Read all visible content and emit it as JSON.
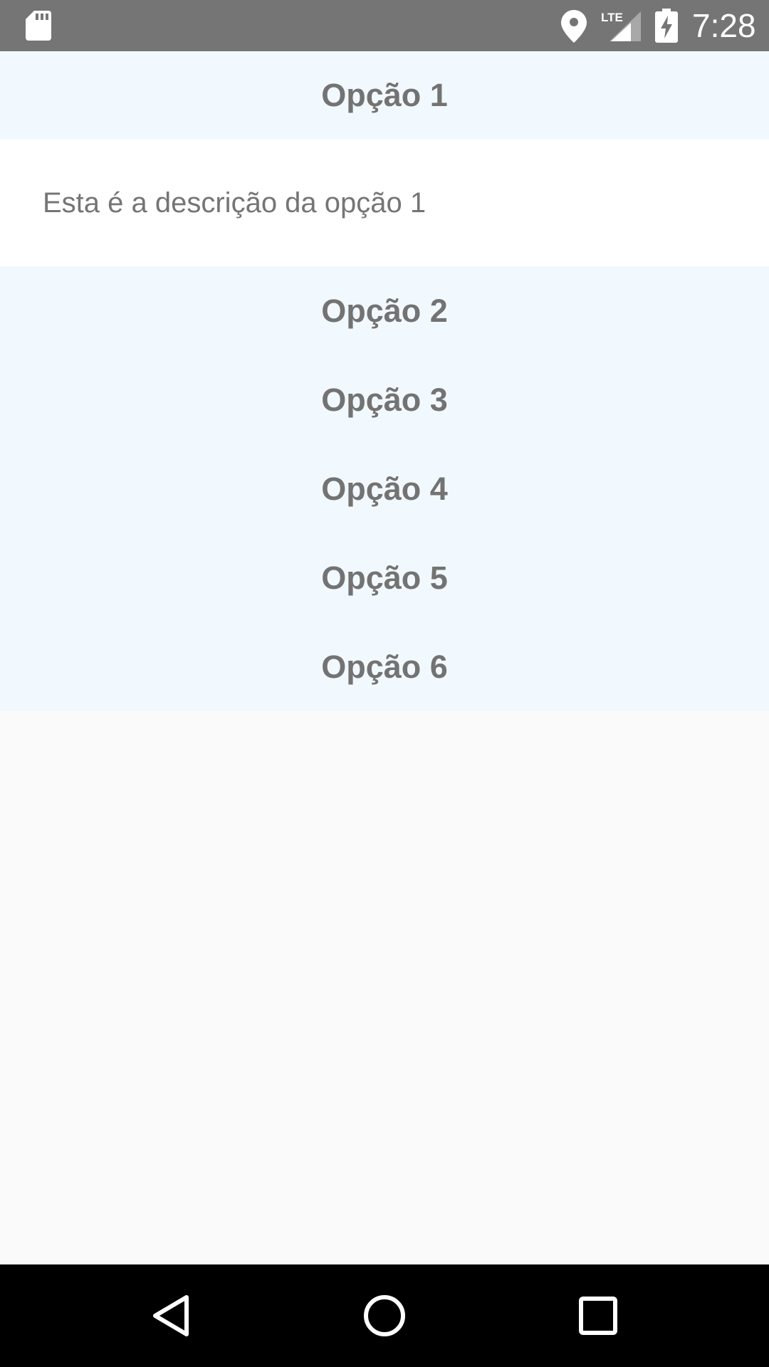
{
  "status_bar": {
    "time": "7:28",
    "network": "LTE",
    "icons": [
      "sd-card-icon",
      "location-icon",
      "lte-signal-icon",
      "battery-charging-icon"
    ]
  },
  "accordion": {
    "items": [
      {
        "title": "Opção 1",
        "description": "Esta é a descrição da opção 1",
        "expanded": true
      },
      {
        "title": "Opção 2"
      },
      {
        "title": "Opção 3"
      },
      {
        "title": "Opção 4"
      },
      {
        "title": "Opção 5"
      },
      {
        "title": "Opção 6"
      }
    ]
  },
  "nav_bar": {
    "icons": [
      "back-icon",
      "home-icon",
      "recents-icon"
    ]
  },
  "colors": {
    "status_bar": "#757575",
    "header_bg": "#f2f9fe",
    "text": "#737373",
    "page_bg": "#fafafa",
    "nav_bar": "#000000"
  }
}
